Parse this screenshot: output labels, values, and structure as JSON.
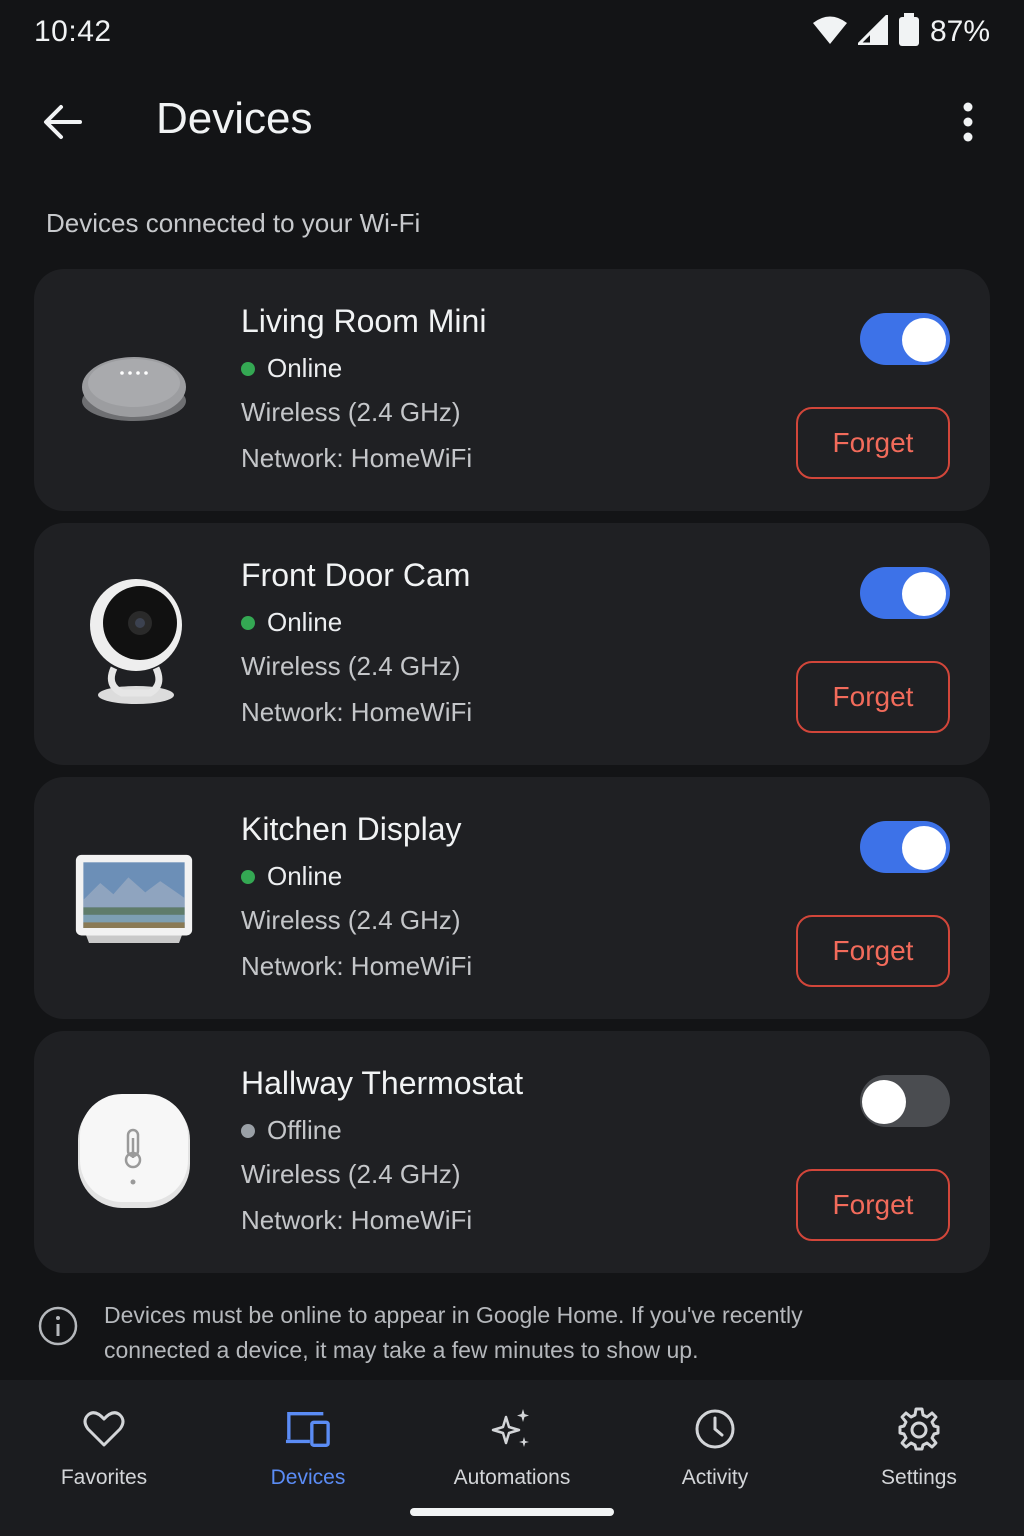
{
  "status_bar": {
    "time": "10:42",
    "battery_percent": "87%",
    "icons": [
      "wifi-icon",
      "cell-signal-icon",
      "battery-icon"
    ]
  },
  "app_bar": {
    "title": "Devices",
    "back_icon": "arrow-back-icon",
    "menu_icon": "more-vert-icon"
  },
  "section_header": "Devices connected to your Wi-Fi",
  "devices": [
    {
      "name": "Living Room Mini",
      "status": "Online",
      "online": true,
      "connection": "Wireless (2.4 GHz)",
      "network": "Network: HomeWiFi",
      "enabled": true,
      "forget_label": "Forget",
      "thumbnail": "smart-speaker"
    },
    {
      "name": "Front Door Cam",
      "status": "Online",
      "online": true,
      "connection": "Wireless (2.4 GHz)",
      "network": "Network: HomeWiFi",
      "enabled": true,
      "forget_label": "Forget",
      "thumbnail": "security-camera"
    },
    {
      "name": "Kitchen Display",
      "status": "Online",
      "online": true,
      "connection": "Wireless (2.4 GHz)",
      "network": "Network: HomeWiFi",
      "enabled": true,
      "forget_label": "Forget",
      "thumbnail": "smart-display"
    },
    {
      "name": "Hallway Thermostat",
      "status": "Offline",
      "online": false,
      "connection": "Wireless (2.4 GHz)",
      "network": "Network: HomeWiFi",
      "enabled": false,
      "forget_label": "Forget",
      "thumbnail": "thermostat-sensor"
    }
  ],
  "info_note": "Devices must be online to appear in Google Home. If you've recently connected a device, it may take a few minutes to show up.",
  "bottom_nav": {
    "active": "Devices",
    "items": [
      {
        "label": "Favorites",
        "icon": "heart-icon"
      },
      {
        "label": "Devices",
        "icon": "devices-icon"
      },
      {
        "label": "Automations",
        "icon": "sparkle-icon"
      },
      {
        "label": "Activity",
        "icon": "clock-icon"
      },
      {
        "label": "Settings",
        "icon": "gear-icon"
      }
    ]
  },
  "colors": {
    "background": "#131416",
    "card": "#1f2023",
    "accent_blue": "#3d72e8",
    "forget_red": "#f26b5b",
    "online_green": "#34a853",
    "offline_gray": "#9aa0a6"
  }
}
